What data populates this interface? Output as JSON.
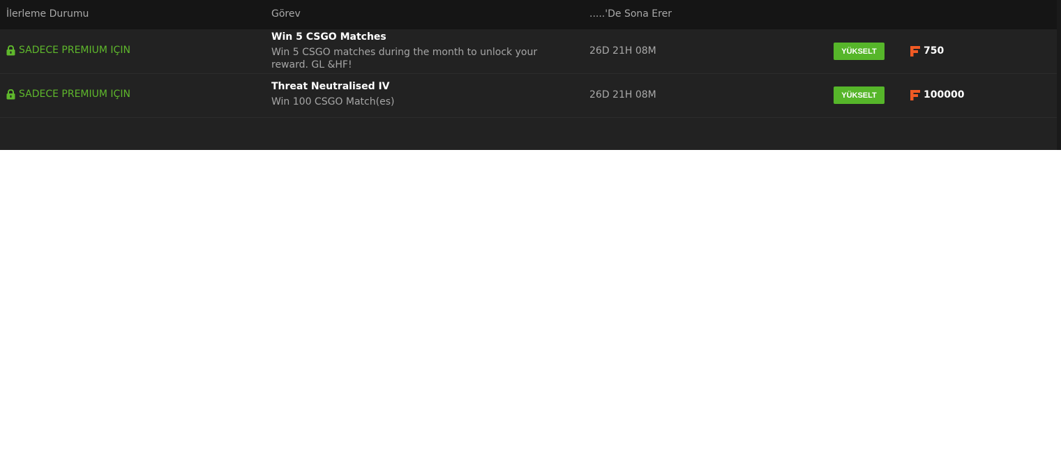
{
  "header": {
    "col_progress": "İlerleme Durumu",
    "col_task": "Görev",
    "col_expires": ".....'De Sona Erer"
  },
  "colors": {
    "status": "#5fb82c",
    "upgrade_button": "#56b62a",
    "reward_icon": "#f05a24"
  },
  "rows": [
    {
      "status": "SADECE PREMIUM IÇIN",
      "status_icon": "lock-icon",
      "title": "Win 5 CSGO Matches",
      "description": "Win 5 CSGO matches during the month to unlock your reward. GL &HF!",
      "expires": "26D 21H 08M",
      "button": "YÜKSELT",
      "reward_icon": "f-coin-icon",
      "reward": "750"
    },
    {
      "status": "SADECE PREMIUM IÇIN",
      "status_icon": "lock-icon",
      "title": "Threat Neutralised IV",
      "description": "Win 100 CSGO Match(es)",
      "expires": "26D 21H 08M",
      "button": "YÜKSELT",
      "reward_icon": "f-coin-icon",
      "reward": "100000"
    }
  ]
}
